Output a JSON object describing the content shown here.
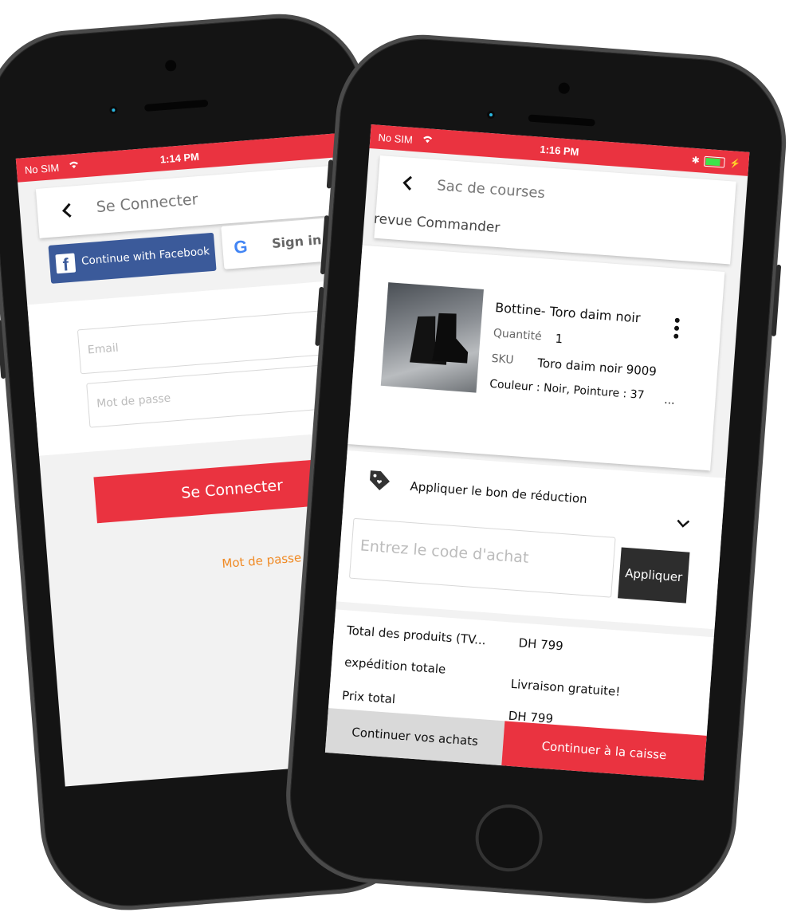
{
  "login": {
    "status": {
      "carrier": "No SIM",
      "time": "1:14 PM"
    },
    "header": {
      "title": "Se Connecter"
    },
    "facebook_label": "Continue with Facebook",
    "google_label": "Sign in",
    "email_placeholder": "Email",
    "password_placeholder": "Mot de passe",
    "submit_label": "Se Connecter",
    "forgot_label": "Mot de passe ou"
  },
  "cart": {
    "status": {
      "carrier": "No SIM",
      "time": "1:16 PM"
    },
    "header": {
      "title": "Sac de courses",
      "subtitle": "revue Commander"
    },
    "product": {
      "name": "Bottine- Toro daim noir",
      "qty_label": "Quantité",
      "qty_value": "1",
      "sku_label": "SKU",
      "sku_value": "Toro daim noir 9009",
      "attributes": "Couleur : Noir, Pointure : 37",
      "ellipsis": "..."
    },
    "coupon": {
      "title": "Appliquer le bon de réduction",
      "placeholder": "Entrez le code d'achat",
      "apply_label": "Appliquer"
    },
    "summary": [
      {
        "label": "Total des produits (TV...",
        "value": "DH 799"
      },
      {
        "label": "expédition totale",
        "value": "Livraison gratuite!"
      },
      {
        "label": "Prix total",
        "value": "DH 799"
      }
    ],
    "footer": {
      "continue_shopping": "Continuer vos achats",
      "checkout": "Continuer à la caisse"
    }
  },
  "colors": {
    "brand_red": "#ea3340",
    "facebook_blue": "#3b5a9a",
    "link_orange": "#f08a24",
    "dark_button": "#2d2d2d"
  }
}
